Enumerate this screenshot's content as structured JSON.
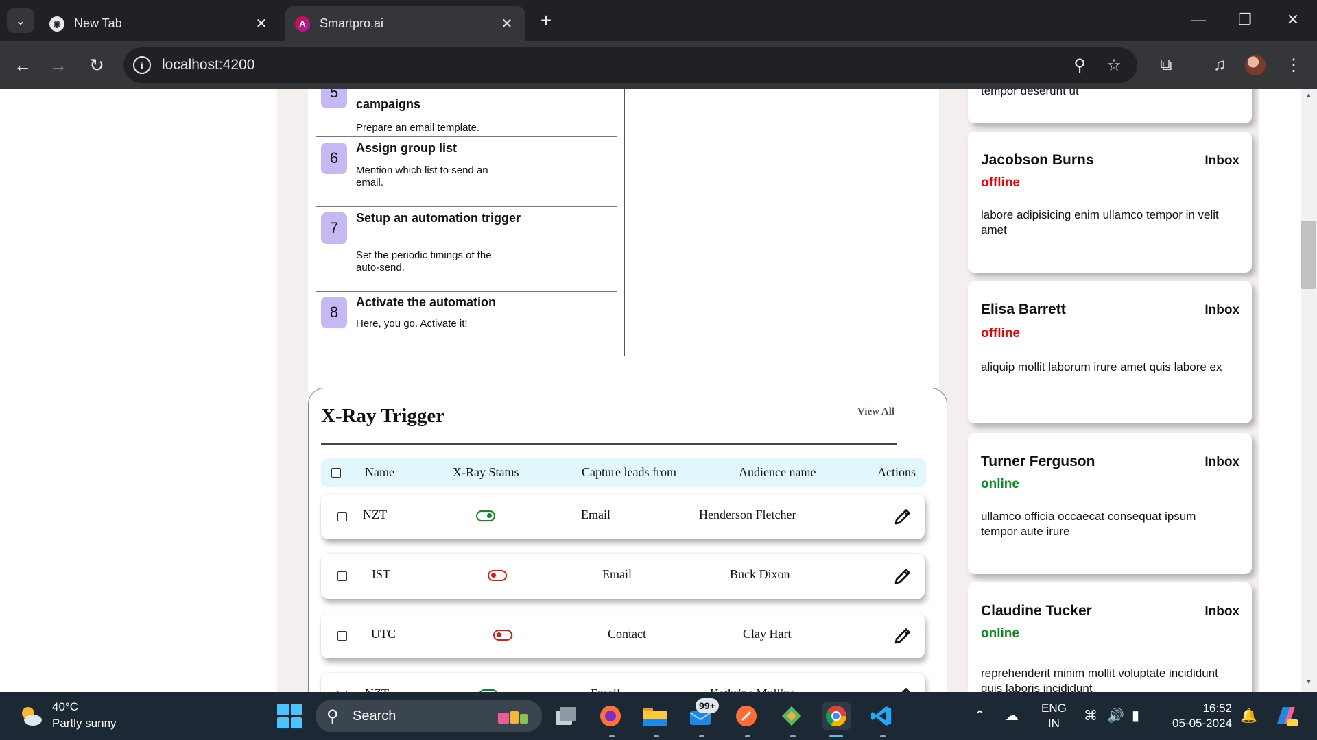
{
  "browser": {
    "tabs": [
      {
        "title": "New Tab",
        "active": false
      },
      {
        "title": "Smartpro.ai",
        "active": true
      }
    ],
    "url": "localhost:4200"
  },
  "steps": [
    {
      "number": "5",
      "title": "campaigns",
      "description": "Prepare an email template."
    },
    {
      "number": "6",
      "title": "Assign group list",
      "description": "Mention which list to send an email."
    },
    {
      "number": "7",
      "title": "Setup an automation trigger",
      "description": "Set the periodic timings of the auto-send."
    },
    {
      "number": "8",
      "title": "Activate the automation",
      "description": "Here, you go. Activate it!"
    }
  ],
  "xray": {
    "title": "X-Ray Trigger",
    "view_all": "View All",
    "columns": [
      "Name",
      "X-Ray Status",
      "Capture leads from",
      "Audience name",
      "Actions"
    ],
    "rows": [
      {
        "name": "NZT",
        "status": "on",
        "capture": "Email",
        "audience": "Henderson Fletcher"
      },
      {
        "name": "IST",
        "status": "off",
        "capture": "Email",
        "audience": "Buck Dixon"
      },
      {
        "name": "UTC",
        "status": "off",
        "capture": "Contact",
        "audience": "Clay Hart"
      },
      {
        "name": "NZT",
        "status": "on",
        "capture": "Email",
        "audience": "Kathrine Mullins"
      }
    ]
  },
  "contacts": [
    {
      "name": "",
      "inbox": "",
      "status": "",
      "message": "tempor deserunt ut"
    },
    {
      "name": "Jacobson Burns",
      "inbox": "Inbox",
      "status": "offline",
      "message": "labore adipisicing enim ullamco tempor in velit amet"
    },
    {
      "name": "Elisa Barrett",
      "inbox": "Inbox",
      "status": "offline",
      "message": "aliquip mollit laborum irure amet quis labore ex"
    },
    {
      "name": "Turner Ferguson",
      "inbox": "Inbox",
      "status": "online",
      "message": "ullamco officia occaecat consequat ipsum tempor aute irure"
    },
    {
      "name": "Claudine Tucker",
      "inbox": "Inbox",
      "status": "online",
      "message": "reprehenderit minim mollit voluptate incididunt quis laboris incididunt"
    }
  ],
  "taskbar": {
    "weather_temp": "40°C",
    "weather_desc": "Partly sunny",
    "search_label": "Search",
    "badge": "99+",
    "lang_top": "ENG",
    "lang_bottom": "IN",
    "time": "16:52",
    "date": "05-05-2024"
  },
  "colors": {
    "online": "#0a8a1f",
    "offline": "#f00000",
    "step_badge": "#c5b8f3",
    "table_header": "#e1f7fc"
  }
}
